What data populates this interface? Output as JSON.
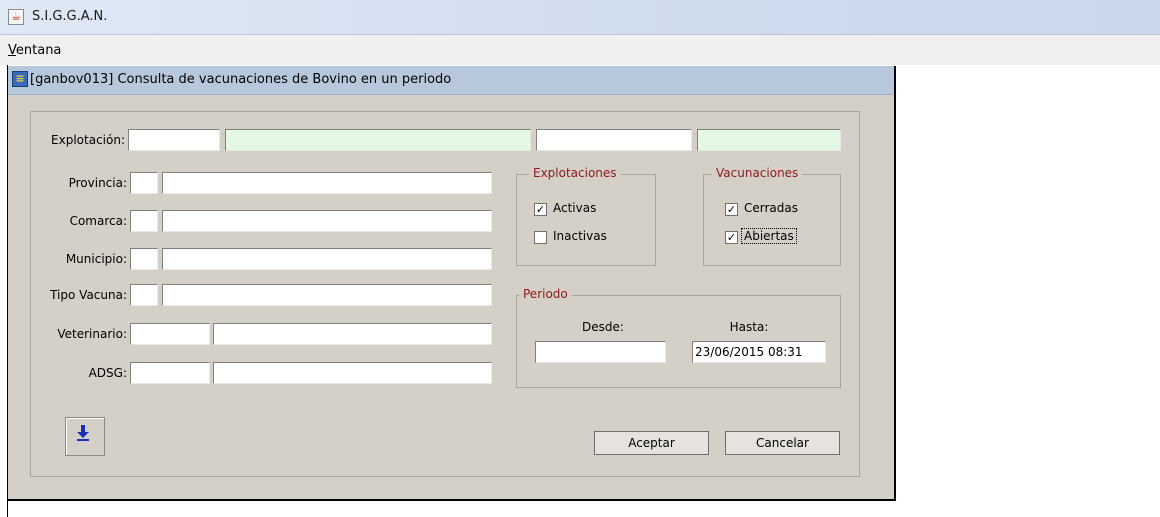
{
  "window": {
    "title": "S.I.G.G.A.N.",
    "icon": "java-cup-icon"
  },
  "menu": {
    "items": [
      {
        "label": "Ventana"
      }
    ]
  },
  "frame": {
    "title": "[ganbov013] Consulta de vacunaciones de Bovino en un periodo",
    "icon": "form-icon"
  },
  "form": {
    "explotacion": {
      "label": "Explotación:",
      "values": [
        "",
        "",
        "",
        ""
      ]
    },
    "provincia": {
      "label": "Provincia:",
      "code": "",
      "name": ""
    },
    "comarca": {
      "label": "Comarca:",
      "code": "",
      "name": ""
    },
    "municipio": {
      "label": "Municipio:",
      "code": "",
      "name": ""
    },
    "tipo_vacuna": {
      "label": "Tipo Vacuna:",
      "code": "",
      "name": ""
    },
    "veterinario": {
      "label": "Veterinario:",
      "code": "",
      "name": ""
    },
    "adsg": {
      "label": "ADSG:",
      "code": "",
      "name": ""
    }
  },
  "explotaciones": {
    "legend": "Explotaciones",
    "activas": {
      "label": "Activas",
      "checked": true
    },
    "inactivas": {
      "label": "Inactivas",
      "checked": false
    }
  },
  "vacunaciones": {
    "legend": "Vacunaciones",
    "cerradas": {
      "label": "Cerradas",
      "checked": true
    },
    "abiertas": {
      "label": "Abiertas",
      "checked": true
    }
  },
  "periodo": {
    "legend": "Periodo",
    "desde": {
      "label": "Desde:",
      "value": ""
    },
    "hasta": {
      "label": "Hasta:",
      "value": "23/06/2015 08:31"
    }
  },
  "buttons": {
    "aceptar": "Aceptar",
    "cancelar": "Cancelar",
    "download_icon": "arrow-down-icon"
  },
  "colors": {
    "legend": "#8b1a1a",
    "panel_bg": "#d4d0c8",
    "frame_title_bg": "#b7c8dc",
    "green_field": "#e4f8e4"
  }
}
